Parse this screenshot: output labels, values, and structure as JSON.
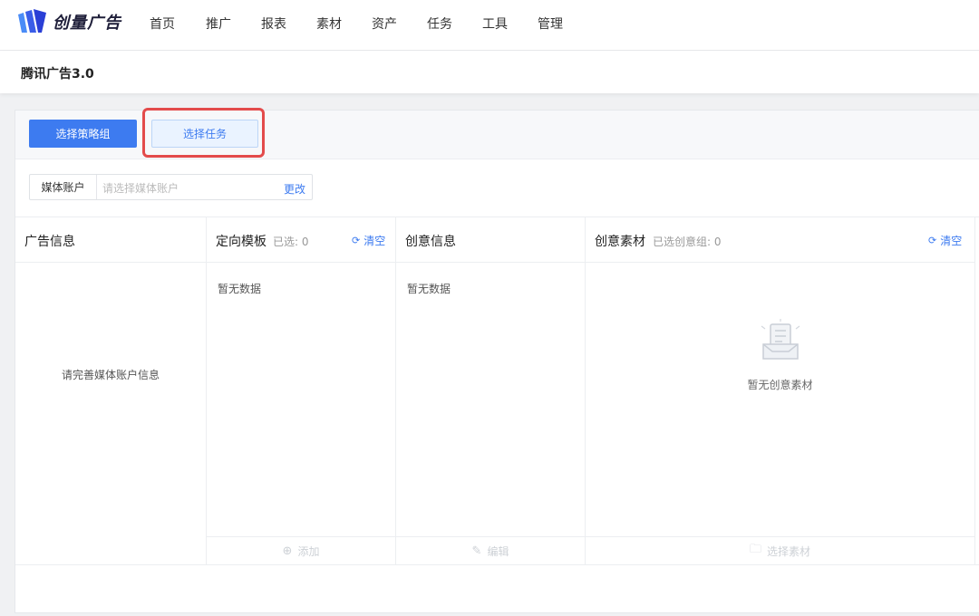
{
  "app": {
    "logo_text": "创量广告"
  },
  "nav": {
    "items": [
      "首页",
      "推广",
      "报表",
      "素材",
      "资产",
      "任务",
      "工具",
      "管理"
    ]
  },
  "subheader": {
    "title": "腾讯广告3.0"
  },
  "toolbar": {
    "select_strategy": "选择策略组",
    "select_task": "选择任务"
  },
  "account": {
    "label": "媒体账户",
    "placeholder": "请选择媒体账户",
    "change": "更改"
  },
  "columns": {
    "ad_info": {
      "title": "广告信息",
      "message": "请完善媒体账户信息"
    },
    "targeting": {
      "title": "定向模板",
      "selected": "已选: 0",
      "clear": "清空",
      "empty": "暂无数据",
      "footer": "添加"
    },
    "creative_info": {
      "title": "创意信息",
      "empty": "暂无数据",
      "footer": "编辑"
    },
    "creative_material": {
      "title": "创意素材",
      "selected": "已选创意组: 0",
      "clear": "清空",
      "empty": "暂无创意素材",
      "footer": "选择素材"
    }
  },
  "colors": {
    "primary": "#3d7bf0",
    "highlight": "#e34b4b"
  },
  "icons": {
    "logo": "creative-logo-icon",
    "refresh": "refresh-icon",
    "add": "plus-circle-icon",
    "edit": "edit-icon",
    "folder": "folder-icon",
    "empty": "empty-box-icon"
  }
}
